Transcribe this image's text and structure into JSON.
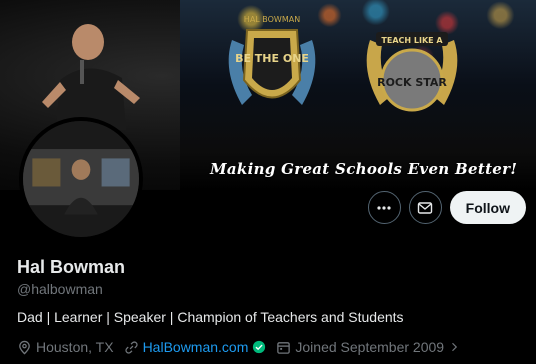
{
  "banner": {
    "tagline": "Making Great Schools Even Better!",
    "emblem_left": "BE THE ONE",
    "emblem_right_top": "TEACH LIKE A",
    "emblem_right_main": "ROCK STAR"
  },
  "profile": {
    "name": "Hal Bowman",
    "handle": "@halbowman",
    "bio": "Dad | Learner | Speaker | Champion of Teachers and Students",
    "location": "Houston, TX",
    "website": "HalBowman.com",
    "joined": "Joined September 2009"
  },
  "actions": {
    "follow_label": "Follow",
    "more_icon": "more-icon",
    "message_icon": "mail-icon"
  },
  "colors": {
    "background": "#000000",
    "link": "#1d9bf0",
    "muted": "#71767b",
    "verified": "#00ba7c"
  }
}
